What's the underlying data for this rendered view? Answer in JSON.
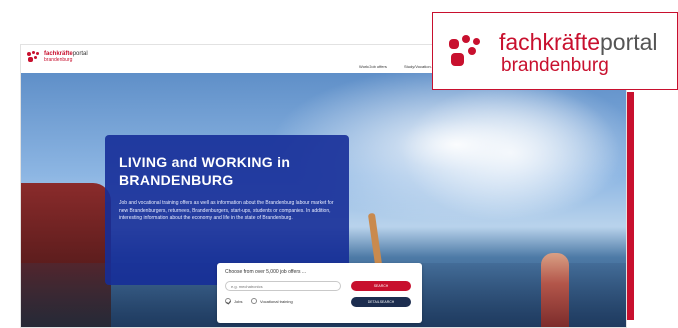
{
  "brand": {
    "name_prefix": "fachkräfte",
    "name_suffix": "portal",
    "region": "brandenburg",
    "color": "#c8102e"
  },
  "nav": {
    "items": [
      "Work/Job offers",
      "Study/Vocation..."
    ]
  },
  "hero": {
    "title_line1": "LIVING and WORKING in",
    "title_line2": "BRANDENBURG",
    "description": "Job and vocational training offers as well as information about the Brandenburg labour market for new Brandenburgers, returnees, Brandenburgers, start-ups, students or companies. In addition, interesting information about the economy and life in the state of Brandenburg."
  },
  "search": {
    "title": "Choose from over 5,000 job offers ...",
    "placeholder": "e.g. mechatronics",
    "search_label": "SEARCH",
    "detail_label": "DETAILSEARCH",
    "options": [
      {
        "label": "Jobs",
        "checked": true
      },
      {
        "label": "Vocational training",
        "checked": false
      }
    ]
  },
  "colors": {
    "accent": "#c8102e",
    "panel_blue": "#162e98",
    "dark_button": "#1c2d4f"
  },
  "icons": {
    "logo": "fachkraefteportal-dots-logo",
    "check": "check-icon"
  }
}
